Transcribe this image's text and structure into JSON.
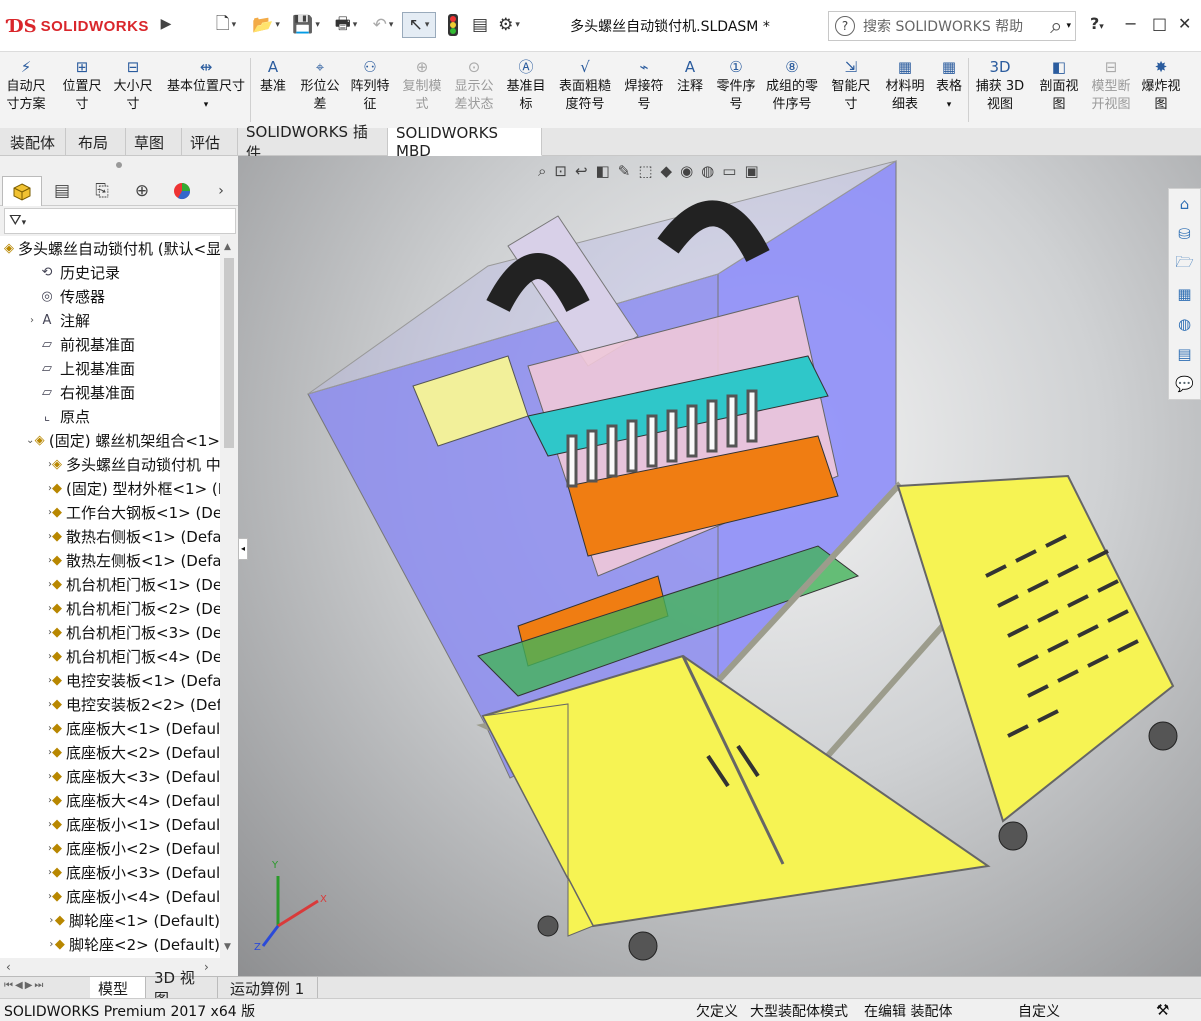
{
  "app": {
    "logo_ds": "3DS",
    "logo_text": "SOLIDWORKS",
    "doc_title": "多头螺丝自动锁付机.SLDASM *"
  },
  "help_search": {
    "placeholder": "搜索 SOLIDWORKS 帮助"
  },
  "window_controls": {
    "help": "?",
    "minimize": "−",
    "restore": "□",
    "close": "✕"
  },
  "ribbon": [
    {
      "id": "auto-dim",
      "label1": "自动尺",
      "label2": "寸方案",
      "icon": "auto-dimension-icon",
      "enabled": true
    },
    {
      "id": "loc-dim",
      "label1": "位置尺",
      "label2": "寸",
      "icon": "location-dimension-icon",
      "enabled": true
    },
    {
      "id": "size-dim",
      "label1": "大小尺",
      "label2": "寸",
      "icon": "size-dimension-icon",
      "enabled": true
    },
    {
      "id": "basic-loc",
      "label1": "基本位置尺寸",
      "label2": "",
      "icon": "basic-location-icon",
      "enabled": true
    },
    {
      "id": "datum",
      "label1": "基准",
      "label2": "",
      "icon": "datum-icon",
      "enabled": true
    },
    {
      "id": "geo-tol",
      "label1": "形位公",
      "label2": "差",
      "icon": "geometric-tolerance-icon",
      "enabled": true
    },
    {
      "id": "pattern-feat",
      "label1": "阵列特",
      "label2": "征",
      "icon": "pattern-feature-icon",
      "enabled": true
    },
    {
      "id": "copy-scheme",
      "label1": "复制模",
      "label2": "式",
      "icon": "copy-scheme-icon",
      "enabled": false
    },
    {
      "id": "show-tol",
      "label1": "显示公",
      "label2": "差状态",
      "icon": "show-tolerance-icon",
      "enabled": false
    },
    {
      "id": "datum-target",
      "label1": "基准目",
      "label2": "标",
      "icon": "datum-target-icon",
      "enabled": true
    },
    {
      "id": "surface-finish",
      "label1": "表面粗糙",
      "label2": "度符号",
      "icon": "surface-finish-icon",
      "enabled": true
    },
    {
      "id": "weld",
      "label1": "焊接符",
      "label2": "号",
      "icon": "weld-symbol-icon",
      "enabled": true
    },
    {
      "id": "note",
      "label1": "注释",
      "label2": "",
      "icon": "note-icon",
      "enabled": true
    },
    {
      "id": "balloon",
      "label1": "零件序",
      "label2": "号",
      "icon": "balloon-icon",
      "enabled": true
    },
    {
      "id": "stacked-balloon",
      "label1": "成组的零",
      "label2": "件序号",
      "icon": "stacked-balloon-icon",
      "enabled": true
    },
    {
      "id": "smart-dim",
      "label1": "智能尺",
      "label2": "寸",
      "icon": "smart-dimension-icon",
      "enabled": true
    },
    {
      "id": "bom",
      "label1": "材料明",
      "label2": "细表",
      "icon": "bom-icon",
      "enabled": true
    },
    {
      "id": "table",
      "label1": "表格",
      "label2": "",
      "icon": "table-icon",
      "enabled": true
    },
    {
      "id": "capture-3d",
      "label1": "捕获 3D",
      "label2": "视图",
      "icon": "capture-3d-view-icon",
      "enabled": true
    },
    {
      "id": "section-view",
      "label1": "剖面视",
      "label2": "图",
      "icon": "section-view-icon",
      "enabled": true
    },
    {
      "id": "break-view",
      "label1": "模型断",
      "label2": "开视图",
      "icon": "model-break-view-icon",
      "enabled": false
    },
    {
      "id": "explode-view",
      "label1": "爆炸视",
      "label2": "图",
      "icon": "explode-view-icon",
      "enabled": true
    }
  ],
  "tabs": [
    "装配体",
    "布局",
    "草图",
    "评估",
    "SOLIDWORKS 插件",
    "SOLIDWORKS MBD"
  ],
  "active_tab": "SOLIDWORKS MBD",
  "filter_icon": "filter-icon",
  "tree": [
    {
      "label": "多头螺丝自动锁付机 (默认<显",
      "depth": 0,
      "expand": "",
      "icon": "assembly-icon"
    },
    {
      "label": "历史记录",
      "depth": 1,
      "expand": "",
      "icon": "history-icon"
    },
    {
      "label": "传感器",
      "depth": 1,
      "expand": "",
      "icon": "sensor-icon"
    },
    {
      "label": "注解",
      "depth": 1,
      "expand": "›",
      "icon": "annotation-icon"
    },
    {
      "label": "前视基准面",
      "depth": 1,
      "expand": "",
      "icon": "plane-icon"
    },
    {
      "label": "上视基准面",
      "depth": 1,
      "expand": "",
      "icon": "plane-icon"
    },
    {
      "label": "右视基准面",
      "depth": 1,
      "expand": "",
      "icon": "plane-icon"
    },
    {
      "label": "原点",
      "depth": 1,
      "expand": "",
      "icon": "origin-icon"
    },
    {
      "label": "(固定) 螺丝机架组合<1>",
      "depth": 1,
      "expand": "⌄",
      "icon": "subassembly-icon"
    },
    {
      "label": "多头螺丝自动锁付机 中",
      "depth": 2,
      "expand": "›",
      "icon": "assembly-icon"
    },
    {
      "label": "(固定) 型材外框<1> (I",
      "depth": 2,
      "expand": "›",
      "icon": "part-icon"
    },
    {
      "label": "工作台大钢板<1> (De",
      "depth": 2,
      "expand": "›",
      "icon": "part-icon"
    },
    {
      "label": "散热右侧板<1> (Defa",
      "depth": 2,
      "expand": "›",
      "icon": "part-icon"
    },
    {
      "label": "散热左侧板<1> (Defa",
      "depth": 2,
      "expand": "›",
      "icon": "part-icon"
    },
    {
      "label": "机台机柜门板<1> (De",
      "depth": 2,
      "expand": "›",
      "icon": "part-icon"
    },
    {
      "label": "机台机柜门板<2> (De",
      "depth": 2,
      "expand": "›",
      "icon": "part-icon"
    },
    {
      "label": "机台机柜门板<3> (De",
      "depth": 2,
      "expand": "›",
      "icon": "part-icon"
    },
    {
      "label": "机台机柜门板<4> (De",
      "depth": 2,
      "expand": "›",
      "icon": "part-icon"
    },
    {
      "label": "电控安装板<1> (Defa",
      "depth": 2,
      "expand": "›",
      "icon": "part-icon"
    },
    {
      "label": "电控安装板2<2> (Def",
      "depth": 2,
      "expand": "›",
      "icon": "part-icon"
    },
    {
      "label": "底座板大<1> (Default",
      "depth": 2,
      "expand": "›",
      "icon": "part-icon"
    },
    {
      "label": "底座板大<2> (Defaul",
      "depth": 2,
      "expand": "›",
      "icon": "part-icon"
    },
    {
      "label": "底座板大<3> (Defaul",
      "depth": 2,
      "expand": "›",
      "icon": "part-icon"
    },
    {
      "label": "底座板大<4> (Defaul",
      "depth": 2,
      "expand": "›",
      "icon": "part-icon"
    },
    {
      "label": "底座板小<1> (Default",
      "depth": 2,
      "expand": "›",
      "icon": "part-icon"
    },
    {
      "label": "底座板小<2> (Defaul",
      "depth": 2,
      "expand": "›",
      "icon": "part-icon"
    },
    {
      "label": "底座板小<3> (Defaul",
      "depth": 2,
      "expand": "›",
      "icon": "part-icon"
    },
    {
      "label": "底座板小<4> (Defaul",
      "depth": 2,
      "expand": "›",
      "icon": "part-icon"
    },
    {
      "label": "脚轮座<1> (Default)",
      "depth": 2,
      "expand": "›",
      "icon": "part-icon"
    },
    {
      "label": "脚轮座<2> (Default)",
      "depth": 2,
      "expand": "›",
      "icon": "part-icon"
    }
  ],
  "bottom_tabs": [
    "模型",
    "3D 视图",
    "运动算例 1"
  ],
  "active_bottom_tab": "模型",
  "status": {
    "product": "SOLIDWORKS Premium 2017 x64 版",
    "under_defined": "欠定义",
    "large_assembly": "大型装配体模式",
    "editing": "在编辑 装配体",
    "custom": "自定义"
  },
  "triad": {
    "x": "X",
    "y": "Y",
    "z": "Z"
  },
  "colors": {
    "frame": "#a7ab92",
    "glass": "#8c8cf0",
    "panel_yellow": "#f6f353",
    "accent_red": "#d9262b"
  }
}
